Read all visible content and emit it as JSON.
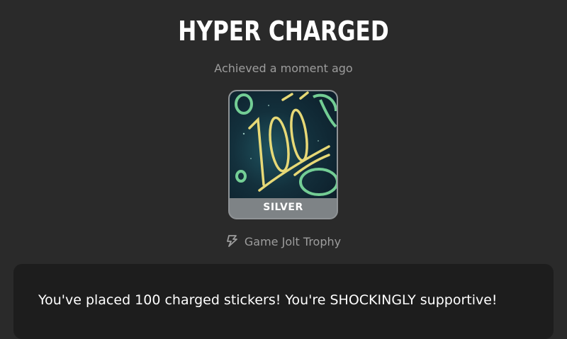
{
  "trophy": {
    "title": "HYPER CHARGED",
    "achieved_text": "Achieved a moment ago",
    "tier": "SILVER",
    "source_label": "Game Jolt Trophy",
    "source_icon": "bolt-icon",
    "image_icon": "100-emoji-art",
    "description": "You've placed 100 charged stickers! You're SHOCKINGLY supportive!"
  },
  "colors": {
    "background": "#2a2a2a",
    "muted_text": "#9d9d9d",
    "silver_tier": "#7e8386",
    "description_box": "#1d1d1d",
    "neon_green": "#7fe0a0",
    "neon_yellow": "#f3e27a"
  }
}
